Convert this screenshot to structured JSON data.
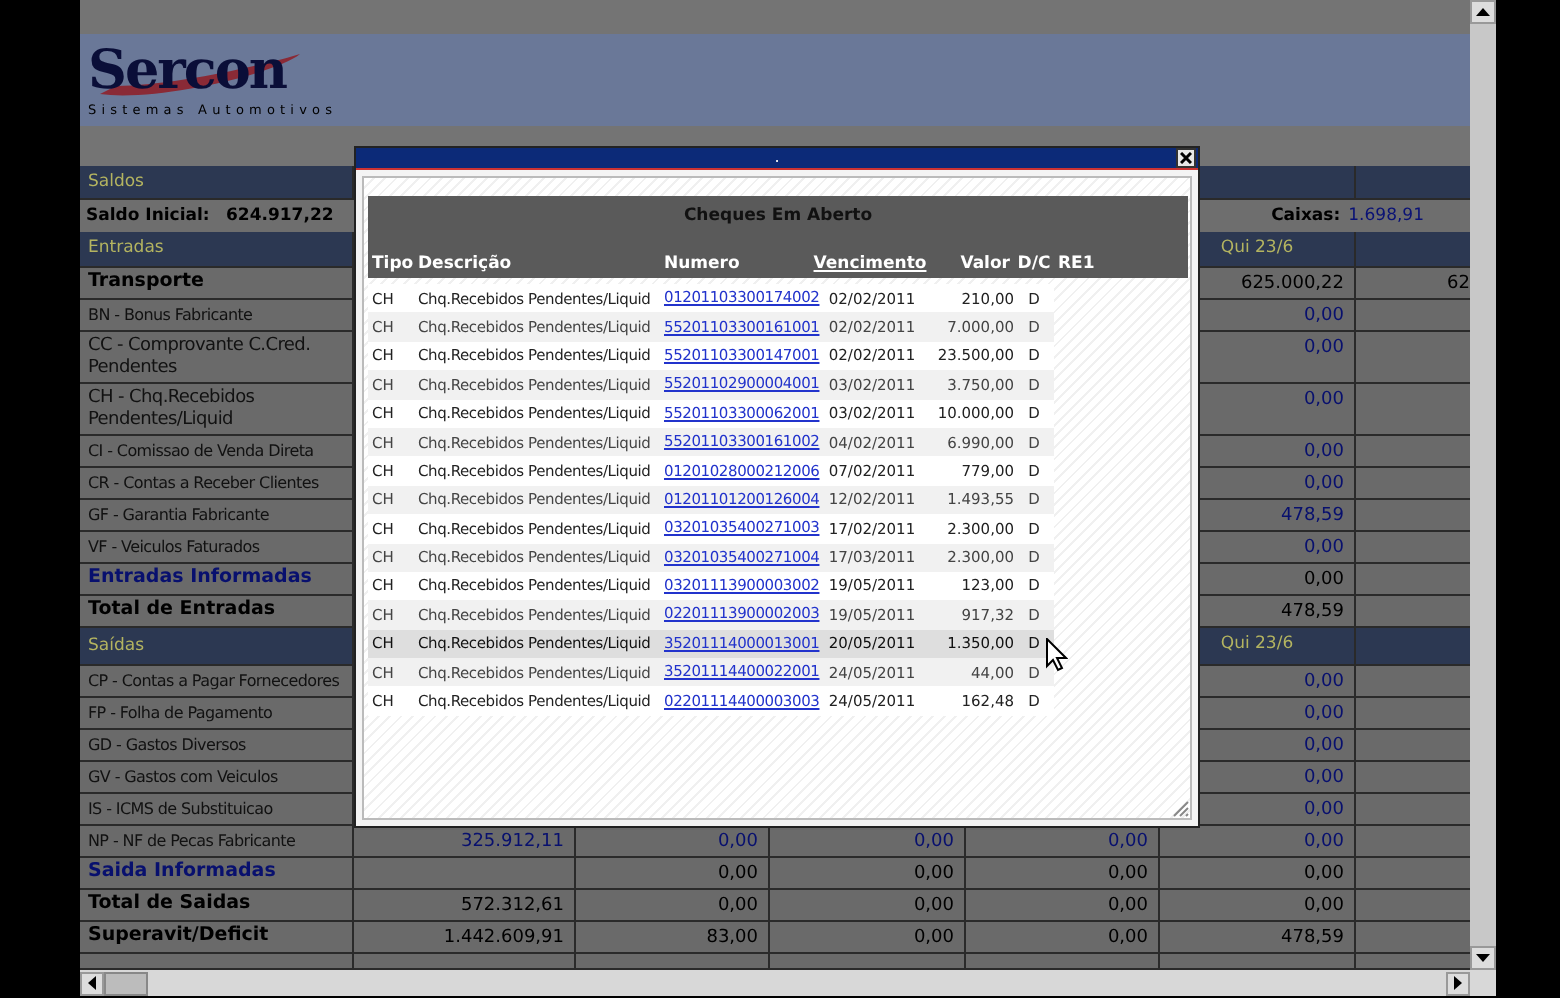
{
  "logo": {
    "name": "Sercon",
    "tagline": "Sistemas Automotivos"
  },
  "rows": [
    {
      "kind": "band",
      "label": "Saldos"
    },
    {
      "kind": "balance",
      "label": "Saldo Inicial:",
      "value": "624.917,22",
      "right_label": "Caixas:",
      "right_value": "1.698,91"
    },
    {
      "kind": "band",
      "label": "Entradas",
      "values": [
        "Qui 23/6"
      ]
    },
    {
      "kind": "total",
      "label": "Transporte",
      "values": [
        "625.000,22"
      ],
      "overflow": "62"
    },
    {
      "kind": "item",
      "label": "BN - Bonus Fabricante",
      "values": [
        "0,00"
      ]
    },
    {
      "kind": "item_wrap",
      "label": "CC - Comprovante C.Cred. Pendentes",
      "values": [
        "0,00"
      ]
    },
    {
      "kind": "item_wrap",
      "label": "CH - Chq.Recebidos Pendentes/Liquid",
      "values": [
        "0,00"
      ]
    },
    {
      "kind": "item",
      "label": "CI - Comissao de Venda Direta",
      "values": [
        "0,00"
      ]
    },
    {
      "kind": "item",
      "label": "CR - Contas a Receber Clientes",
      "values": [
        "0,00"
      ]
    },
    {
      "kind": "item",
      "label": "GF - Garantia Fabricante",
      "values": [
        "478,59"
      ]
    },
    {
      "kind": "item",
      "label": "VF - Veiculos Faturados",
      "values": [
        "0,00"
      ]
    },
    {
      "kind": "informed",
      "label": "Entradas Informadas",
      "values": [
        "0,00"
      ]
    },
    {
      "kind": "total",
      "label": "Total de Entradas",
      "values": [
        "478,59"
      ]
    },
    {
      "kind": "band",
      "label": "Saídas",
      "values": [
        "Qui 23/6"
      ]
    },
    {
      "kind": "item",
      "label": "CP - Contas a Pagar Fornecedores",
      "values": [
        "0,00"
      ]
    },
    {
      "kind": "item",
      "label": "FP - Folha de Pagamento",
      "values": [
        "0,00"
      ]
    },
    {
      "kind": "item",
      "label": "GD - Gastos Diversos",
      "values": [
        "0,00"
      ]
    },
    {
      "kind": "item",
      "label": "GV - Gastos com Veiculos",
      "values": [
        "0,00"
      ]
    },
    {
      "kind": "item",
      "label": "IS - ICMS de Substituicao",
      "values": [
        "0,00"
      ]
    },
    {
      "kind": "item",
      "label": "NP - NF de Pecas Fabricante",
      "values": [
        "325.912,11",
        "0,00",
        "0,00",
        "0,00",
        "0,00"
      ]
    },
    {
      "kind": "informed",
      "label": "Saida Informadas",
      "values": [
        "0,00",
        "0,00",
        "0,00",
        "0,00"
      ]
    },
    {
      "kind": "total",
      "label": "Total de Saidas",
      "values": [
        "572.312,61",
        "0,00",
        "0,00",
        "0,00",
        "0,00"
      ]
    },
    {
      "kind": "total",
      "label": "Superavit/Deficit",
      "values": [
        "1.442.609,91",
        "83,00",
        "0,00",
        "0,00",
        "478,59"
      ]
    },
    {
      "kind": "partial"
    }
  ],
  "dialog": {
    "title": ".",
    "table_title": "Cheques Em Aberto",
    "columns": [
      "Tipo",
      "Descrição",
      "Numero",
      "Vencimento",
      "Valor",
      "D/C",
      "RE1"
    ],
    "rows": [
      {
        "tipo": "CH",
        "descricao": "Chq.Recebidos Pendentes/Liquid",
        "numero": "01201103300174002",
        "vencimento": "02/02/2011",
        "valor": "210,00",
        "dc": "D",
        "selected": false
      },
      {
        "tipo": "CH",
        "descricao": "Chq.Recebidos Pendentes/Liquid",
        "numero": "55201103300161001",
        "vencimento": "02/02/2011",
        "valor": "7.000,00",
        "dc": "D",
        "selected": false
      },
      {
        "tipo": "CH",
        "descricao": "Chq.Recebidos Pendentes/Liquid",
        "numero": "55201103300147001",
        "vencimento": "02/02/2011",
        "valor": "23.500,00",
        "dc": "D",
        "selected": false
      },
      {
        "tipo": "CH",
        "descricao": "Chq.Recebidos Pendentes/Liquid",
        "numero": "55201102900004001",
        "vencimento": "03/02/2011",
        "valor": "3.750,00",
        "dc": "D",
        "selected": false
      },
      {
        "tipo": "CH",
        "descricao": "Chq.Recebidos Pendentes/Liquid",
        "numero": "55201103300062001",
        "vencimento": "03/02/2011",
        "valor": "10.000,00",
        "dc": "D",
        "selected": false
      },
      {
        "tipo": "CH",
        "descricao": "Chq.Recebidos Pendentes/Liquid",
        "numero": "55201103300161002",
        "vencimento": "04/02/2011",
        "valor": "6.990,00",
        "dc": "D",
        "selected": false
      },
      {
        "tipo": "CH",
        "descricao": "Chq.Recebidos Pendentes/Liquid",
        "numero": "01201028000212006",
        "vencimento": "07/02/2011",
        "valor": "779,00",
        "dc": "D",
        "selected": false
      },
      {
        "tipo": "CH",
        "descricao": "Chq.Recebidos Pendentes/Liquid",
        "numero": "01201101200126004",
        "vencimento": "12/02/2011",
        "valor": "1.493,55",
        "dc": "D",
        "selected": false
      },
      {
        "tipo": "CH",
        "descricao": "Chq.Recebidos Pendentes/Liquid",
        "numero": "03201035400271003",
        "vencimento": "17/02/2011",
        "valor": "2.300,00",
        "dc": "D",
        "selected": false
      },
      {
        "tipo": "CH",
        "descricao": "Chq.Recebidos Pendentes/Liquid",
        "numero": "03201035400271004",
        "vencimento": "17/03/2011",
        "valor": "2.300,00",
        "dc": "D",
        "selected": false
      },
      {
        "tipo": "CH",
        "descricao": "Chq.Recebidos Pendentes/Liquid",
        "numero": "03201113900003002",
        "vencimento": "19/05/2011",
        "valor": "123,00",
        "dc": "D",
        "selected": false
      },
      {
        "tipo": "CH",
        "descricao": "Chq.Recebidos Pendentes/Liquid",
        "numero": "02201113900002003",
        "vencimento": "19/05/2011",
        "valor": "917,32",
        "dc": "D",
        "selected": false
      },
      {
        "tipo": "CH",
        "descricao": "Chq.Recebidos Pendentes/Liquid",
        "numero": "35201114000013001",
        "vencimento": "20/05/2011",
        "valor": "1.350,00",
        "dc": "D",
        "selected": true
      },
      {
        "tipo": "CH",
        "descricao": "Chq.Recebidos Pendentes/Liquid",
        "numero": "35201114400022001",
        "vencimento": "24/05/2011",
        "valor": "44,00",
        "dc": "D",
        "selected": false
      },
      {
        "tipo": "CH",
        "descricao": "Chq.Recebidos Pendentes/Liquid",
        "numero": "02201114400003003",
        "vencimento": "24/05/2011",
        "valor": "162,48",
        "dc": "D",
        "selected": false
      }
    ]
  }
}
